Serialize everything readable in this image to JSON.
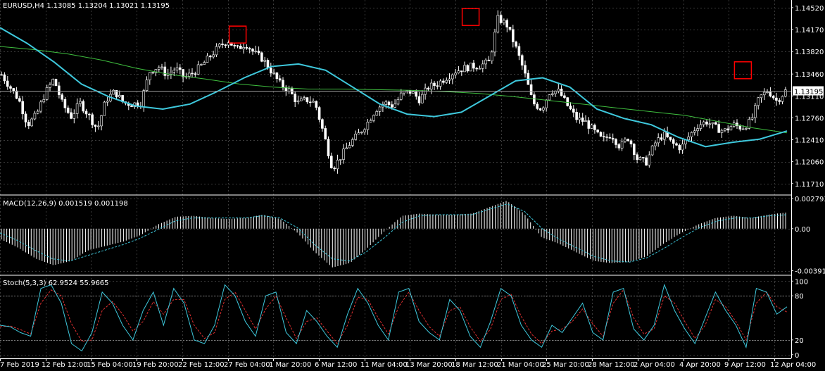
{
  "chart_data": [
    {
      "type": "candlestick",
      "title": "EURUSD,H4  1.13085 1.13204 1.13021 1.13195",
      "symbol": "EURUSD",
      "timeframe": "H4",
      "ohlc": {
        "open": 1.13085,
        "high": 1.13204,
        "low": 1.13021,
        "close": 1.13195
      },
      "current_price_label": "1.13195",
      "current_price": 1.13195,
      "ylim": [
        1.1155,
        1.1462
      ],
      "y_ticks": [
        {
          "label": "1.14520",
          "value": 1.1452
        },
        {
          "label": "1.14170",
          "value": 1.1417
        },
        {
          "label": "1.13820",
          "value": 1.1382
        },
        {
          "label": "1.13460",
          "value": 1.1346
        },
        {
          "label": "1.13110",
          "value": 1.1311
        },
        {
          "label": "1.12760",
          "value": 1.1276
        },
        {
          "label": "1.12410",
          "value": 1.1241
        },
        {
          "label": "1.12060",
          "value": 1.1206
        },
        {
          "label": "1.11710",
          "value": 1.1171
        }
      ],
      "grid": true,
      "series": [
        {
          "kind": "close-path",
          "color": "#ffffff",
          "values": [
            1.1345,
            1.1325,
            1.1305,
            1.1265,
            1.128,
            1.1315,
            1.1338,
            1.1298,
            1.1278,
            1.13,
            1.128,
            1.1258,
            1.1305,
            1.1318,
            1.13,
            1.1298,
            1.13,
            1.135,
            1.1358,
            1.1345,
            1.1355,
            1.134,
            1.1348,
            1.136,
            1.1375,
            1.139,
            1.14,
            1.1385,
            1.1395,
            1.138,
            1.137,
            1.135,
            1.133,
            1.132,
            1.13,
            1.1305,
            1.13,
            1.125,
            1.1195,
            1.1215,
            1.1235,
            1.125,
            1.1268,
            1.129,
            1.13,
            1.1295,
            1.1315,
            1.1318,
            1.1305,
            1.1325,
            1.133,
            1.134,
            1.135,
            1.1355,
            1.1358,
            1.136,
            1.1365,
            1.1435,
            1.1425,
            1.139,
            1.135,
            1.13,
            1.129,
            1.132,
            1.1318,
            1.1295,
            1.1275,
            1.127,
            1.1255,
            1.124,
            1.125,
            1.123,
            1.1245,
            1.121,
            1.1205,
            1.1235,
            1.125,
            1.1235,
            1.1228,
            1.1248,
            1.1265,
            1.127,
            1.126,
            1.1255,
            1.1265,
            1.126,
            1.127,
            1.1308,
            1.132,
            1.1303,
            1.1319
          ]
        },
        {
          "kind": "moving-average",
          "color": "#3ec8dc",
          "values": [
            1.142,
            1.1395,
            1.1365,
            1.133,
            1.131,
            1.1295,
            1.129,
            1.1298,
            1.1318,
            1.134,
            1.1358,
            1.1362,
            1.1352,
            1.1325,
            1.1298,
            1.1282,
            1.1278,
            1.1285,
            1.131,
            1.1335,
            1.134,
            1.1325,
            1.129,
            1.1275,
            1.1265,
            1.1245,
            1.123,
            1.1237,
            1.1242,
            1.1255
          ]
        },
        {
          "kind": "moving-average",
          "color": "#3fbf3f",
          "values": [
            1.139,
            1.1385,
            1.1378,
            1.1368,
            1.1355,
            1.1345,
            1.1338,
            1.133,
            1.1325,
            1.1322,
            1.1322,
            1.1321,
            1.132,
            1.1318,
            1.1315,
            1.131,
            1.1304,
            1.1298,
            1.1292,
            1.1286,
            1.128,
            1.127,
            1.126,
            1.1252
          ]
        }
      ],
      "markers": [
        {
          "kind": "square",
          "color": "#ff0000",
          "x": 0.302,
          "price": 1.1409
        },
        {
          "kind": "square",
          "color": "#ff0000",
          "x": 0.598,
          "price": 1.1437
        },
        {
          "kind": "square",
          "color": "#ff0000",
          "x": 0.944,
          "price": 1.1352
        }
      ]
    },
    {
      "type": "histogram",
      "title": "MACD(12,26,9) 0.001519 0.001198",
      "ylim": [
        -0.0042,
        0.003
      ],
      "y_ticks": [
        {
          "label": "0.002793",
          "value": 0.002793
        },
        {
          "label": "0.00",
          "value": 0.0
        },
        {
          "label": "-0.00391",
          "value": -0.00391
        }
      ],
      "series": [
        {
          "kind": "macd-histogram",
          "color": "#ffffff",
          "values": [
            -0.001,
            -0.0018,
            -0.0028,
            -0.0034,
            -0.003,
            -0.002,
            -0.0016,
            -0.0012,
            -0.0006,
            0.0004,
            0.0011,
            0.0012,
            0.001,
            0.0009,
            0.001,
            0.0013,
            0.0009,
            -0.0004,
            -0.0022,
            -0.0036,
            -0.0032,
            -0.0018,
            -0.0002,
            0.0012,
            0.0014,
            0.0013,
            0.0013,
            0.0014,
            0.002,
            0.0026,
            0.0014,
            -0.0008,
            -0.0014,
            -0.0022,
            -0.003,
            -0.0032,
            -0.0031,
            -0.0026,
            -0.0014,
            -0.0004,
            0.0004,
            0.001,
            0.0012,
            0.001,
            0.0013,
            0.0015
          ]
        },
        {
          "kind": "signal",
          "color": "#3ec8dc",
          "values": [
            -0.0004,
            -0.0011,
            -0.002,
            -0.0028,
            -0.003,
            -0.0025,
            -0.002,
            -0.0015,
            -0.0009,
            -0.0001,
            0.0007,
            0.001,
            0.001,
            0.001,
            0.001,
            0.0012,
            0.001,
            0.0001,
            -0.0015,
            -0.0028,
            -0.003,
            -0.0021,
            -0.0008,
            0.0006,
            0.0012,
            0.0013,
            0.0013,
            0.0013,
            0.0018,
            0.0023,
            0.0016,
            0.0,
            -0.001,
            -0.0018,
            -0.0026,
            -0.003,
            -0.0031,
            -0.0027,
            -0.0018,
            -0.0008,
            0.0001,
            0.0007,
            0.001,
            0.001,
            0.0012,
            0.0013
          ]
        }
      ]
    },
    {
      "type": "line",
      "title": "Stoch(5,3,3) 62.9524 55.9665",
      "ylim": [
        -5,
        106
      ],
      "y_ticks": [
        {
          "label": "100",
          "value": 100
        },
        {
          "label": "80",
          "value": 80
        },
        {
          "label": "20",
          "value": 20
        },
        {
          "label": "0",
          "value": 0
        }
      ],
      "levels": [
        80,
        20
      ],
      "series": [
        {
          "kind": "%K",
          "color": "#3ec8dc",
          "values": [
            40,
            38,
            30,
            25,
            90,
            95,
            70,
            15,
            5,
            30,
            85,
            70,
            40,
            20,
            60,
            85,
            40,
            90,
            70,
            20,
            15,
            40,
            95,
            80,
            45,
            25,
            80,
            85,
            30,
            15,
            60,
            45,
            25,
            10,
            55,
            90,
            70,
            40,
            20,
            85,
            90,
            45,
            30,
            20,
            75,
            60,
            25,
            10,
            45,
            90,
            80,
            40,
            20,
            10,
            40,
            30,
            50,
            70,
            30,
            20,
            85,
            90,
            35,
            20,
            40,
            95,
            60,
            35,
            15,
            50,
            85,
            60,
            40,
            10,
            90,
            85,
            55,
            65
          ]
        },
        {
          "kind": "%D",
          "color": "#e03030",
          "values": [
            38,
            39,
            34,
            28,
            70,
            88,
            80,
            42,
            18,
            20,
            60,
            72,
            55,
            32,
            45,
            72,
            55,
            75,
            75,
            40,
            22,
            30,
            75,
            85,
            60,
            35,
            62,
            80,
            50,
            22,
            45,
            50,
            32,
            15,
            40,
            78,
            75,
            50,
            28,
            65,
            85,
            60,
            38,
            25,
            60,
            65,
            38,
            18,
            35,
            75,
            82,
            52,
            28,
            15,
            32,
            35,
            45,
            62,
            42,
            25,
            70,
            88,
            50,
            28,
            35,
            80,
            70,
            45,
            22,
            40,
            75,
            65,
            45,
            20,
            70,
            85,
            65,
            58
          ]
        }
      ]
    }
  ],
  "x_axis": {
    "labels": [
      "7 Feb 2019",
      "12 Feb 12:00",
      "15 Feb 04:00",
      "19 Feb 20:00",
      "22 Feb 12:00",
      "27 Feb 04:00",
      "1 Mar 20:00",
      "6 Mar 12:00",
      "11 Mar 04:00",
      "13 Mar 20:00",
      "18 Mar 12:00",
      "21 Mar 04:00",
      "25 Mar 20:00",
      "28 Mar 12:00",
      "2 Apr 04:00",
      "4 Apr 20:00",
      "9 Apr 12:00",
      "12 Apr 04:00"
    ]
  },
  "colors": {
    "background": "#000000",
    "grid": "#3a3a3a",
    "text": "#ffffff",
    "separator": "#ffffff"
  }
}
